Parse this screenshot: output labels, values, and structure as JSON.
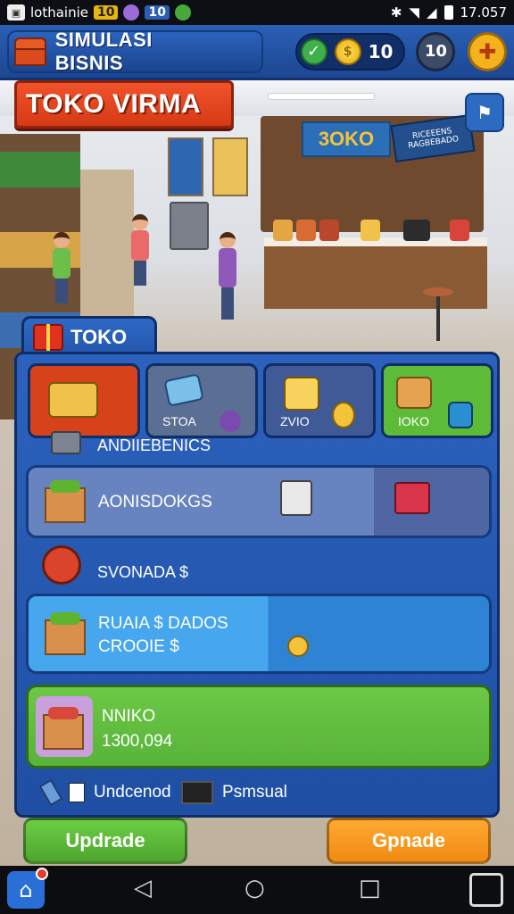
{
  "status_bar": {
    "app_name": "lothainie",
    "badge_1": "10",
    "badge_2": "10",
    "time": "17.057"
  },
  "header": {
    "title": "SIMULASI BISNIS",
    "currency_value": "10",
    "level": "10"
  },
  "scene": {
    "banner": "TOKO VIRMA",
    "wall_sign": "3OKO",
    "small_sign": "RICEEENS RAGBEBADO"
  },
  "panel": {
    "tab_label": "TOKO",
    "categories": [
      {
        "label": ""
      },
      {
        "label": "STOA"
      },
      {
        "label": "ZVIO"
      },
      {
        "label": "IOKO"
      }
    ],
    "section_1": "ANDIIEBENICS",
    "row_1": "AONISDOKGS",
    "section_2": "SVONADA $",
    "row_2_line1": "RUAIA  $  DADOS",
    "row_2_line2": "CROOIE  $",
    "row_3_line1": "NNIKO",
    "row_3_line2": "1300,094",
    "footer_item_1": "Undcenod",
    "footer_item_2": "Psmsual"
  },
  "buttons": {
    "upgrade_left": "Updrade",
    "upgrade_right": "Gpnade"
  },
  "colors": {
    "panel_blue": "#2356ad",
    "accent_orange": "#f6931e",
    "accent_green": "#58b33a",
    "accent_red": "#d63b16"
  }
}
